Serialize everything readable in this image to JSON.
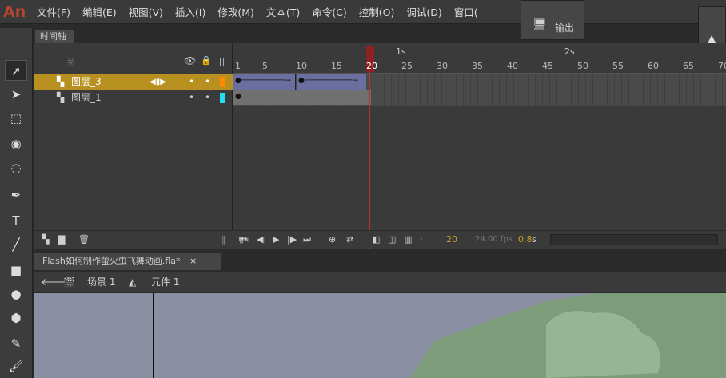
{
  "app": {
    "logo": "An"
  },
  "menu": [
    "文件(F)",
    "编辑(E)",
    "视图(V)",
    "插入(I)",
    "修改(M)",
    "文本(T)",
    "命令(C)",
    "控制(O)",
    "调试(D)",
    "窗口("
  ],
  "output_panel": {
    "label": "输出"
  },
  "timeline": {
    "tab": "时间轴",
    "layers_header": "关",
    "layers": [
      {
        "name": "图层_3",
        "selected": true,
        "color": "#ff8a00"
      },
      {
        "name": "图层_1",
        "selected": false,
        "color": "#22e0f0"
      }
    ],
    "ruler": [
      "1",
      "5",
      "10",
      "15",
      "20",
      "25",
      "30",
      "35",
      "40",
      "45",
      "50",
      "55",
      "60",
      "65",
      "70"
    ],
    "seconds": [
      "1s",
      "2s"
    ],
    "current_frame": "20",
    "fps": "24.00 fps",
    "elapsed": "0.8",
    "elapsed_unit": "s"
  },
  "document": {
    "tab": "Flash如何制作萤火虫飞舞动画.fla*",
    "close": "×"
  },
  "breadcrumb": {
    "scene": "场景 1",
    "symbol": "元件 1"
  },
  "colors": {
    "accent": "#b89020",
    "tween": "#6a6fa0"
  }
}
